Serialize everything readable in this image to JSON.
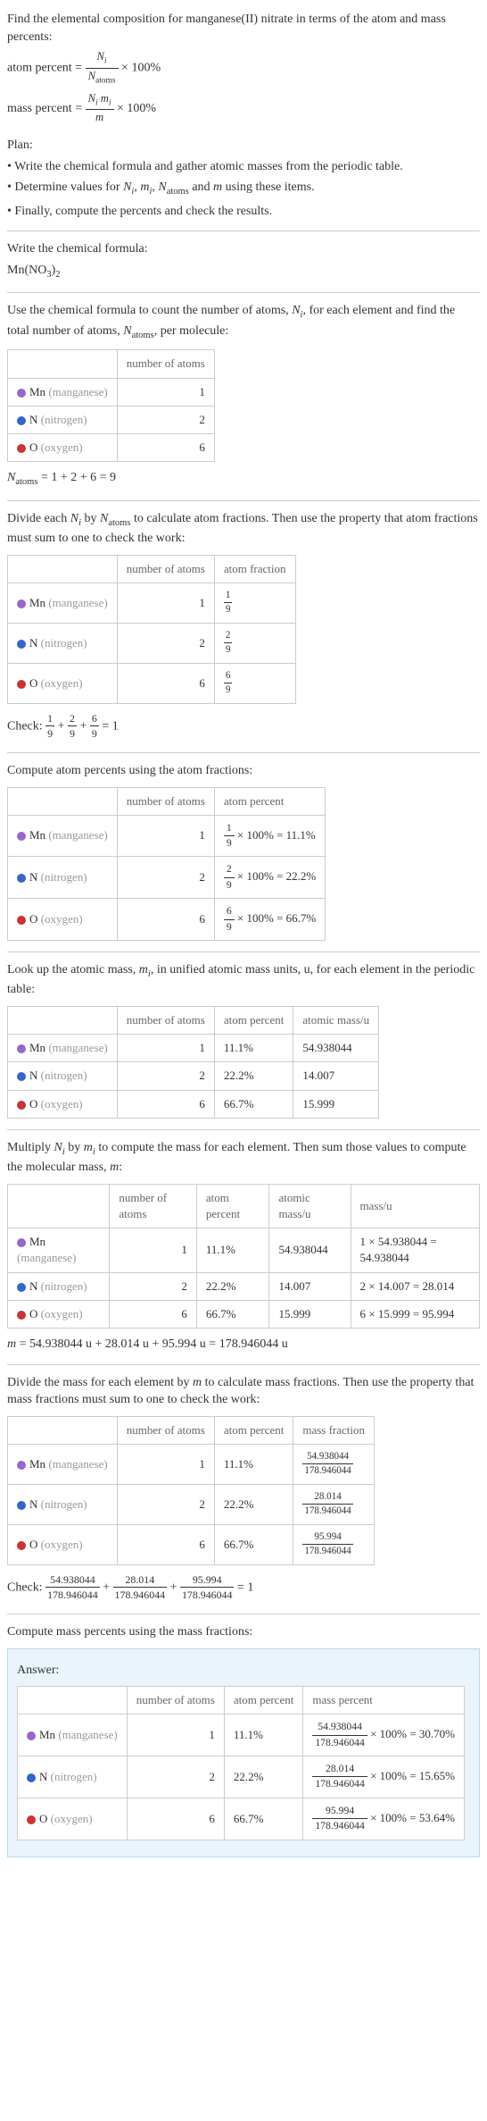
{
  "intro": {
    "line1": "Find the elemental composition for manganese(II) nitrate in terms of the atom and mass percents:",
    "atom_pct_label": "atom percent =",
    "atom_pct_frac_num": "N_i",
    "atom_pct_frac_den": "N_atoms",
    "times100": "× 100%",
    "mass_pct_label": "mass percent =",
    "mass_pct_frac_num": "N_i m_i",
    "mass_pct_frac_den": "m"
  },
  "plan": {
    "heading": "Plan:",
    "b1": "• Write the chemical formula and gather atomic masses from the periodic table.",
    "b2_a": "• Determine values for ",
    "b2_b": " using these items.",
    "b3": "• Finally, compute the percents and check the results."
  },
  "formula": {
    "heading": "Write the chemical formula:",
    "text": "Mn(NO",
    "sub1": "3",
    "mid": ")",
    "sub2": "2"
  },
  "count": {
    "heading_a": "Use the chemical formula to count the number of atoms, ",
    "heading_b": ", for each element and find the total number of atoms, ",
    "heading_c": ", per molecule:",
    "col_num": "number of atoms",
    "mn_label": "Mn",
    "mn_paren": "(manganese)",
    "mn_val": "1",
    "n_label": "N",
    "n_paren": "(nitrogen)",
    "n_val": "2",
    "o_label": "O",
    "o_paren": "(oxygen)",
    "o_val": "6",
    "total": "N_atoms = 1 + 2 + 6 = 9"
  },
  "atomfrac": {
    "heading": "Divide each N_i by N_atoms to calculate atom fractions. Then use the property that atom fractions must sum to one to check the work:",
    "col_num": "number of atoms",
    "col_frac": "atom fraction",
    "mn_n": "1",
    "mn_f_n": "1",
    "mn_f_d": "9",
    "n_n": "2",
    "n_f_n": "2",
    "n_f_d": "9",
    "o_n": "6",
    "o_f_n": "6",
    "o_f_d": "9",
    "check_label": "Check: ",
    "check_eq": " = 1"
  },
  "atompct": {
    "heading": "Compute atom percents using the atom fractions:",
    "col_num": "number of atoms",
    "col_pct": "atom percent",
    "mn_n": "1",
    "mn_expr": " × 100% = 11.1%",
    "n_n": "2",
    "n_expr": " × 100% = 22.2%",
    "o_n": "6",
    "o_expr": " × 100% = 66.7%"
  },
  "atomicmass": {
    "heading": "Look up the atomic mass, m_i, in unified atomic mass units, u, for each element in the periodic table:",
    "col_num": "number of atoms",
    "col_pct": "atom percent",
    "col_mass": "atomic mass/u",
    "mn_n": "1",
    "mn_p": "11.1%",
    "mn_m": "54.938044",
    "n_n": "2",
    "n_p": "22.2%",
    "n_m": "14.007",
    "o_n": "6",
    "o_p": "66.7%",
    "o_m": "15.999"
  },
  "molmass": {
    "heading": "Multiply N_i by m_i to compute the mass for each element. Then sum those values to compute the molecular mass, m:",
    "col_num": "number of atoms",
    "col_pct": "atom percent",
    "col_amass": "atomic mass/u",
    "col_mass": "mass/u",
    "mn_n": "1",
    "mn_p": "11.1%",
    "mn_am": "54.938044",
    "mn_mass": "1 × 54.938044 = 54.938044",
    "n_n": "2",
    "n_p": "22.2%",
    "n_am": "14.007",
    "n_mass": "2 × 14.007 = 28.014",
    "o_n": "6",
    "o_p": "66.7%",
    "o_am": "15.999",
    "o_mass": "6 × 15.999 = 95.994",
    "total": "m = 54.938044 u + 28.014 u + 95.994 u = 178.946044 u"
  },
  "massfrac": {
    "heading": "Divide the mass for each element by m to calculate mass fractions. Then use the property that mass fractions must sum to one to check the work:",
    "col_num": "number of atoms",
    "col_pct": "atom percent",
    "col_mf": "mass fraction",
    "mn_n": "1",
    "mn_p": "11.1%",
    "mn_num": "54.938044",
    "mn_den": "178.946044",
    "n_n": "2",
    "n_p": "22.2%",
    "n_num": "28.014",
    "n_den": "178.946044",
    "o_n": "6",
    "o_p": "66.7%",
    "o_num": "95.994",
    "o_den": "178.946044",
    "check_label": "Check: ",
    "check_eq": " = 1"
  },
  "masspct": {
    "heading": "Compute mass percents using the mass fractions:"
  },
  "answer": {
    "label": "Answer:",
    "col_num": "number of atoms",
    "col_ap": "atom percent",
    "col_mp": "mass percent",
    "mn_n": "1",
    "mn_ap": "11.1%",
    "mn_num": "54.938044",
    "mn_den": "178.946044",
    "mn_res": "× 100% = 30.70%",
    "n_n": "2",
    "n_ap": "22.2%",
    "n_num": "28.014",
    "n_den": "178.946044",
    "n_res": "× 100% = 15.65%",
    "o_n": "6",
    "o_ap": "66.7%",
    "o_num": "95.994",
    "o_den": "178.946044",
    "o_res": "× 100% = 53.64%"
  },
  "chart_data": {
    "type": "table",
    "title": "Elemental composition of Mn(NO3)2",
    "elements": [
      {
        "symbol": "Mn",
        "name": "manganese",
        "atoms": 1,
        "atom_fraction": "1/9",
        "atom_percent": 11.1,
        "atomic_mass_u": 54.938044,
        "mass_u": 54.938044,
        "mass_fraction_num": 54.938044,
        "mass_fraction_den": 178.946044,
        "mass_percent": 30.7
      },
      {
        "symbol": "N",
        "name": "nitrogen",
        "atoms": 2,
        "atom_fraction": "2/9",
        "atom_percent": 22.2,
        "atomic_mass_u": 14.007,
        "mass_u": 28.014,
        "mass_fraction_num": 28.014,
        "mass_fraction_den": 178.946044,
        "mass_percent": 15.65
      },
      {
        "symbol": "O",
        "name": "oxygen",
        "atoms": 6,
        "atom_fraction": "6/9",
        "atom_percent": 66.7,
        "atomic_mass_u": 15.999,
        "mass_u": 95.994,
        "mass_fraction_num": 95.994,
        "mass_fraction_den": 178.946044,
        "mass_percent": 53.64
      }
    ],
    "N_atoms": 9,
    "molecular_mass_u": 178.946044
  }
}
